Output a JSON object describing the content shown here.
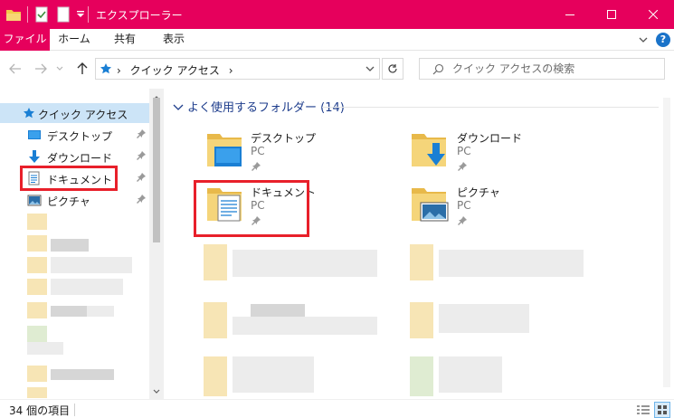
{
  "window": {
    "title": "エクスプローラー"
  },
  "ribbon": {
    "tabs": [
      "ファイル",
      "ホーム",
      "共有",
      "表示"
    ],
    "help_icon": "?"
  },
  "address_bar": {
    "path": "クイック アクセス",
    "separator": "›"
  },
  "search": {
    "placeholder": "クイック アクセスの検索"
  },
  "nav_pane": {
    "quick_access": "クイック アクセス",
    "items": [
      {
        "label": "デスクトップ",
        "icon": "desktop-icon",
        "pinned": true
      },
      {
        "label": "ダウンロード",
        "icon": "download-icon",
        "pinned": true
      },
      {
        "label": "ドキュメント",
        "icon": "document-icon",
        "pinned": true
      },
      {
        "label": "ピクチャ",
        "icon": "picture-icon",
        "pinned": true
      }
    ]
  },
  "content": {
    "group_title": "よく使用するフォルダー (14)",
    "tiles": [
      {
        "name": "デスクトップ",
        "sub": "PC",
        "icon": "desktop-folder-icon"
      },
      {
        "name": "ダウンロード",
        "sub": "PC",
        "icon": "download-folder-icon"
      },
      {
        "name": "ドキュメント",
        "sub": "PC",
        "icon": "document-folder-icon"
      },
      {
        "name": "ピクチャ",
        "sub": "PC",
        "icon": "picture-folder-icon"
      }
    ]
  },
  "status_bar": {
    "item_count": "34 個の項目"
  },
  "colors": {
    "accent": "#e6005c",
    "highlight": "#e8202a",
    "selection": "#cce4f7",
    "group_title": "#1e3d8c"
  }
}
